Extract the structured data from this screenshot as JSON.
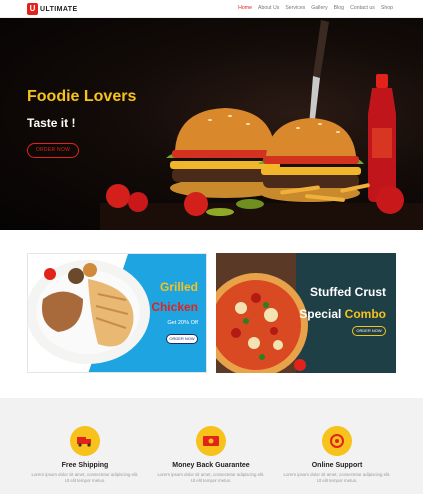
{
  "brand": {
    "logo_letter": "U",
    "name": "ULTIMATE",
    "accent": "#e2231a",
    "yellow": "#f7c21b"
  },
  "nav": {
    "items": [
      "Home",
      "About Us",
      "Services",
      "Gallery",
      "Blog",
      "Contact us",
      "Shop"
    ],
    "active": "Home"
  },
  "hero": {
    "title": "Foodie Lovers",
    "subtitle": "Taste it !",
    "button": "ORDER NOW"
  },
  "promo_left": {
    "line1": "Grilled",
    "line2": "Chicken",
    "offer": "Get 20% Off",
    "button": "ORDER NOW"
  },
  "promo_right": {
    "line1": "Stuffed Crust",
    "line2_a": "Special",
    "line2_b": "Combo",
    "button": "ORDER NOW"
  },
  "features": [
    {
      "title": "Free Shipping",
      "desc1": "Lorem ipsum dolor sit amet, consectetur adipiscing elit.",
      "desc2": "Ut elit tempor metus.",
      "icon": "truck-icon"
    },
    {
      "title": "Money Back Guarantee",
      "desc1": "Lorem ipsum dolor sit amet, consectetur adipiscing elit.",
      "desc2": "Ut elit tempor metus.",
      "icon": "money-icon"
    },
    {
      "title": "Online Support",
      "desc1": "Lorem ipsum dolor sit amet, consectetur adipiscing elit.",
      "desc2": "Ut elit tempor metus.",
      "icon": "support-icon"
    }
  ]
}
